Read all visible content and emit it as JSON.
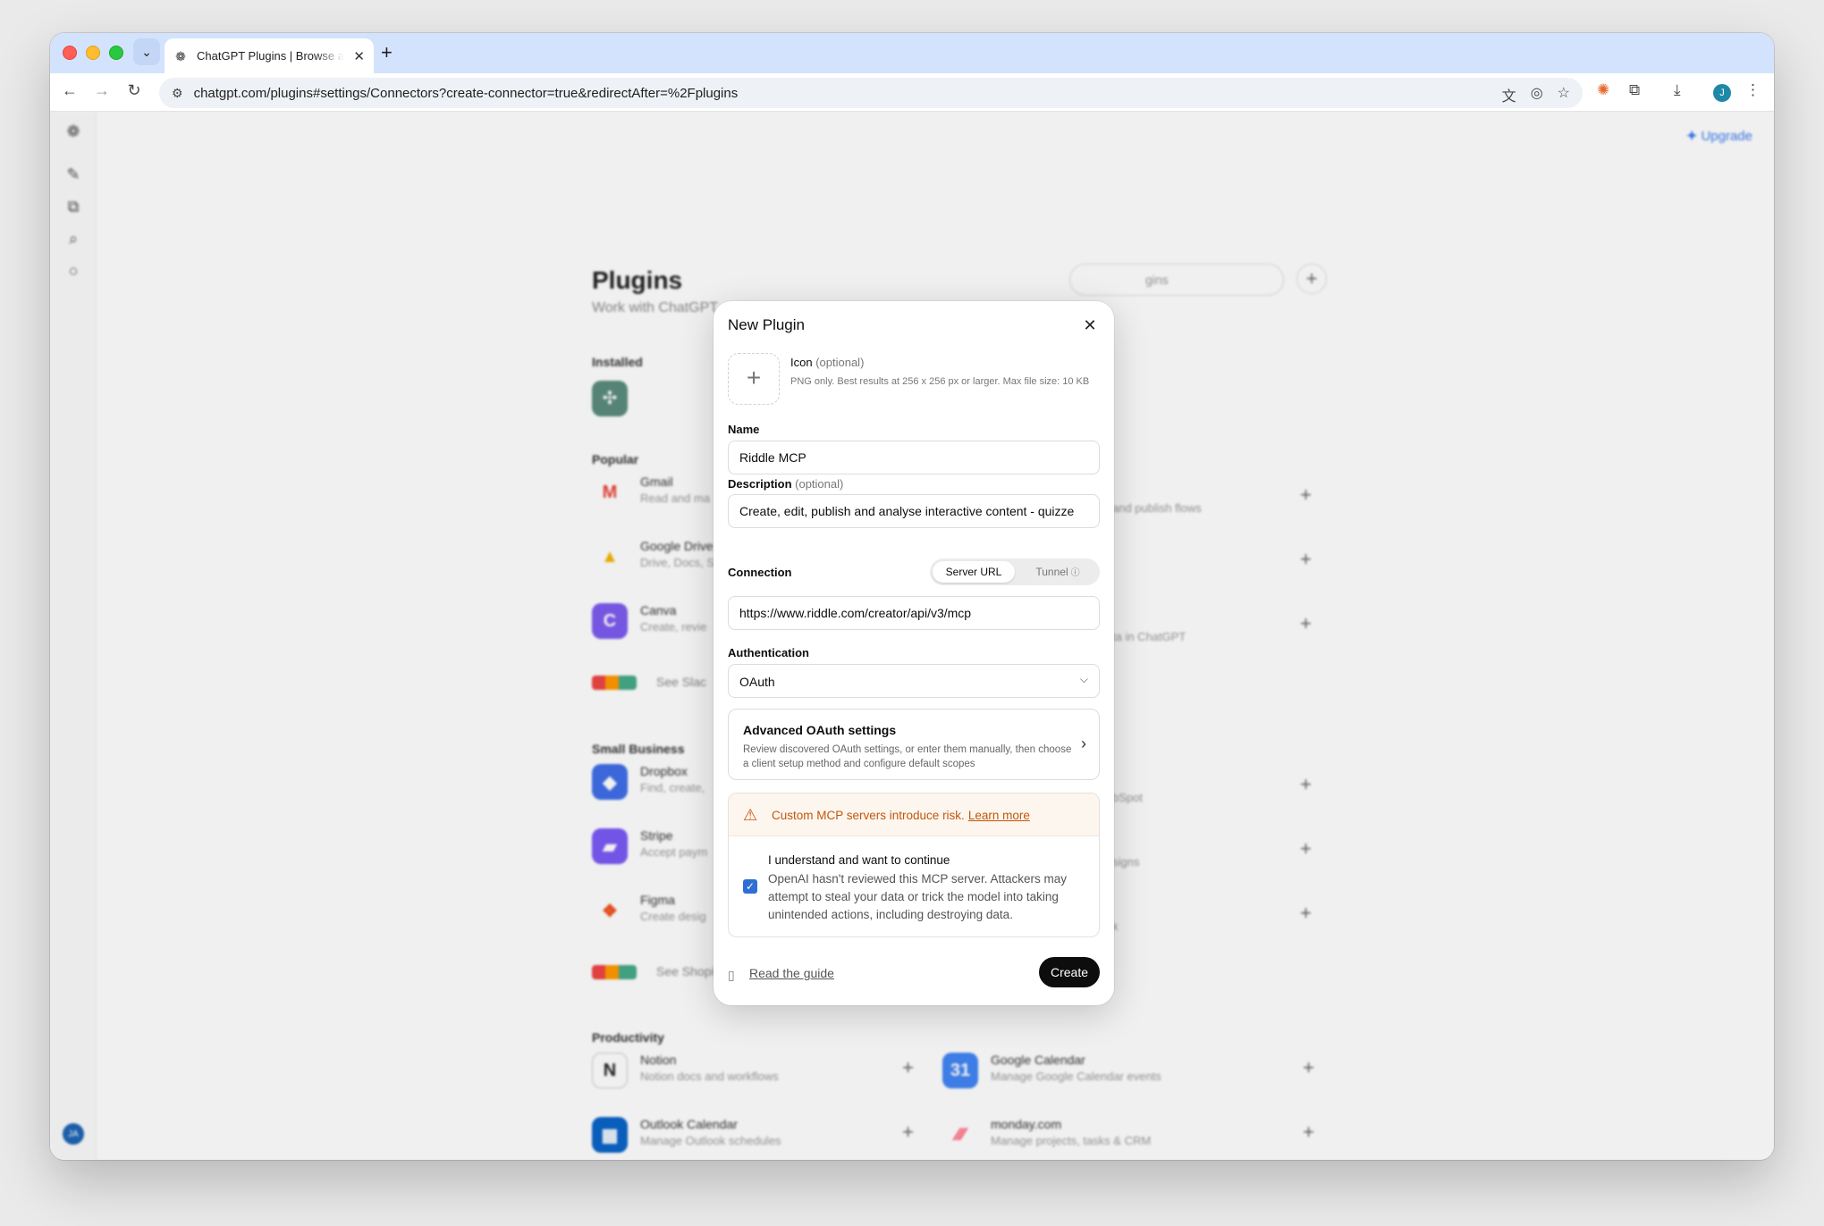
{
  "browser": {
    "tab_title": "ChatGPT Plugins | Browse an",
    "url": "chatgpt.com/plugins#settings/Connectors?create-connector=true&redirectAfter=%2Fplugins",
    "profile_initial": "J"
  },
  "header": {
    "upgrade_label": "Upgrade"
  },
  "sidebar": {
    "avatar_initials": "JA"
  },
  "background": {
    "title": "Plugins",
    "subtitle": "Work with ChatGPT",
    "search_placeholder": "gins",
    "sections": {
      "installed": "Installed",
      "popular": "Popular",
      "small_business": "Small Business",
      "productivity": "Productivity"
    },
    "popular_apps": [
      {
        "name": "Gmail",
        "desc": "Read and ma",
        "color": "#ffffff"
      },
      {
        "name": "Google Drive",
        "desc": "Drive, Docs, S",
        "color": "#ffffff"
      },
      {
        "name": "Canva",
        "desc": "Create, revie",
        "color": "#7d5cf0"
      }
    ],
    "popular_right": [
      "and publish flows",
      "",
      "ta in ChatGPT"
    ],
    "popular_more": "See Slac",
    "small_business_apps": [
      {
        "name": "Dropbox",
        "desc": "Find, create,",
        "color": "#3f6ee8"
      },
      {
        "name": "Stripe",
        "desc": "Accept paym",
        "color": "#7a5af5"
      },
      {
        "name": "Figma",
        "desc": "Create desig",
        "color": "#ffffff"
      }
    ],
    "small_business_right": [
      "bSpot",
      "signs",
      "k"
    ],
    "small_business_more": "See Shopify, Wix, and more",
    "productivity_apps": [
      {
        "name": "Notion",
        "desc": "Notion docs and workflows"
      },
      {
        "name": "Google Calendar",
        "desc": "Manage Google Calendar events"
      },
      {
        "name": "Outlook Calendar",
        "desc": "Manage Outlook schedules"
      },
      {
        "name": "monday.com",
        "desc": "Manage projects, tasks & CRM"
      }
    ]
  },
  "modal": {
    "title": "New Plugin",
    "icon": {
      "label": "Icon",
      "optional": "(optional)",
      "hint": "PNG only. Best results at 256 x 256 px or larger. Max file size: 10 KB"
    },
    "name": {
      "label": "Name",
      "value": "Riddle MCP"
    },
    "description": {
      "label": "Description",
      "optional": "(optional)",
      "value": "Create, edit, publish and analyse interactive content - quizze"
    },
    "connection": {
      "label": "Connection",
      "options": [
        "Server URL",
        "Tunnel"
      ],
      "selected": "Server URL",
      "url_value": "https://www.riddle.com/creator/api/v3/mcp"
    },
    "authentication": {
      "label": "Authentication",
      "selected": "OAuth"
    },
    "advanced": {
      "title": "Advanced OAuth settings",
      "desc": "Review discovered OAuth settings, or enter them manually, then choose a client setup method and configure default scopes"
    },
    "risk": {
      "warning": "Custom MCP servers introduce risk.",
      "link": "Learn more",
      "ack_title": "I understand and want to continue",
      "ack_desc": "OpenAI hasn't reviewed this MCP server. Attackers may attempt to steal your data or trick the model into taking unintended actions, including destroying data.",
      "checked": true
    },
    "footer": {
      "guide_link": "Read the guide",
      "create_label": "Create"
    }
  },
  "colors": {
    "accent_blue": "#2f6fd3",
    "warning_orange": "#c2570c",
    "primary_button": "#0d0d0d"
  }
}
